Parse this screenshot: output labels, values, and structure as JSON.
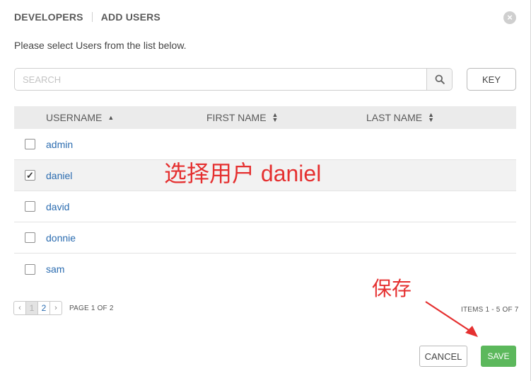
{
  "header": {
    "section": "DEVELOPERS",
    "title": "ADD USERS"
  },
  "instructions": "Please select Users from the list below.",
  "search": {
    "placeholder": "SEARCH",
    "value": "",
    "icon": "search-icon"
  },
  "key_button": "KEY",
  "table": {
    "columns": [
      {
        "label": "USERNAME",
        "sort": "ascending"
      },
      {
        "label": "FIRST NAME",
        "sort": "none"
      },
      {
        "label": "LAST NAME",
        "sort": "none"
      }
    ],
    "rows": [
      {
        "username": "admin",
        "first_name": "",
        "last_name": "",
        "checked": false
      },
      {
        "username": "daniel",
        "first_name": "",
        "last_name": "",
        "checked": true
      },
      {
        "username": "david",
        "first_name": "",
        "last_name": "",
        "checked": false
      },
      {
        "username": "donnie",
        "first_name": "",
        "last_name": "",
        "checked": false
      },
      {
        "username": "sam",
        "first_name": "",
        "last_name": "",
        "checked": false
      }
    ]
  },
  "annotations": {
    "select_user": "选择用户 daniel",
    "save": "保存",
    "color": "#e53030"
  },
  "pagination": {
    "prev": "‹",
    "pages": [
      "1",
      "2"
    ],
    "current_page": "1",
    "next": "›",
    "page_info": "PAGE 1 OF 2",
    "items_info": "ITEMS  1 - 5 OF 7"
  },
  "footer": {
    "cancel_label": "CANCEL",
    "save_label": "SAVE",
    "save_color": "#5cb85c"
  }
}
